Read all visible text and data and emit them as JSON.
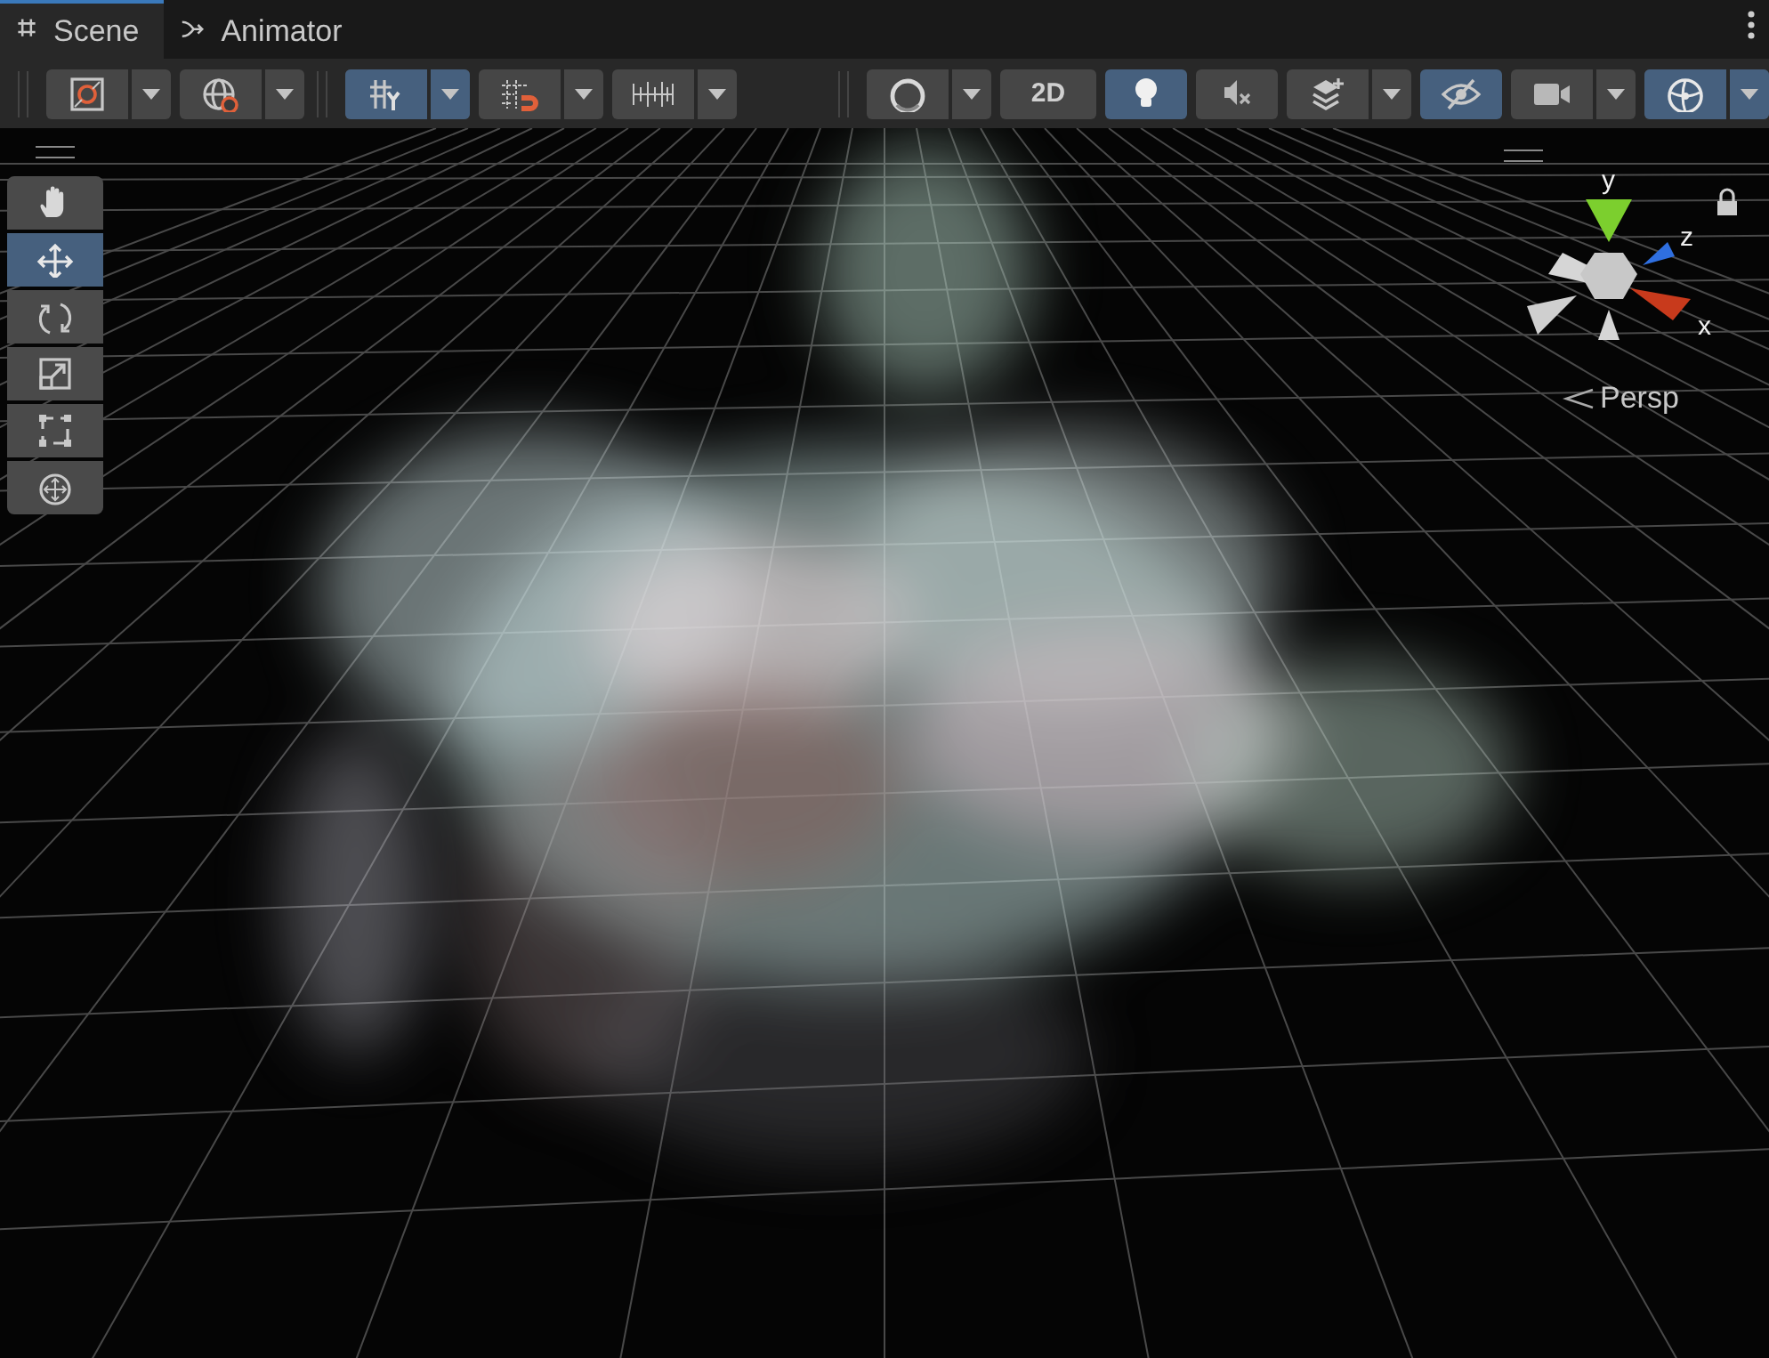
{
  "tabs": [
    {
      "label": "Scene",
      "selected": true
    },
    {
      "label": "Animator",
      "selected": false
    }
  ],
  "toolbar": {
    "left": [
      [
        {
          "on": false,
          "dropdown": true
        },
        {
          "on": false,
          "dropdown": true
        }
      ],
      [
        {
          "on": true,
          "dropdown": true
        },
        {
          "on": false,
          "dropdown": true
        },
        {
          "on": false,
          "dropdown": true
        }
      ]
    ],
    "right": [
      {
        "on": false,
        "dropdown": true
      },
      {
        "label": "2D",
        "on": false,
        "dropdown": false
      },
      {
        "on": true,
        "dropdown": false
      },
      {
        "on": false,
        "dropdown": false
      },
      {
        "on": false,
        "dropdown": true
      },
      {
        "on": true,
        "dropdown": false
      },
      {
        "on": false,
        "dropdown": true
      },
      {
        "on": true,
        "dropdown": true
      }
    ]
  },
  "tools": [
    {
      "selected": false
    },
    {
      "selected": true
    },
    {
      "selected": false
    },
    {
      "selected": false
    },
    {
      "selected": false
    },
    {
      "selected": false
    }
  ],
  "gizmo": {
    "axes": [
      "y",
      "z",
      "x"
    ],
    "projection": "Persp"
  }
}
